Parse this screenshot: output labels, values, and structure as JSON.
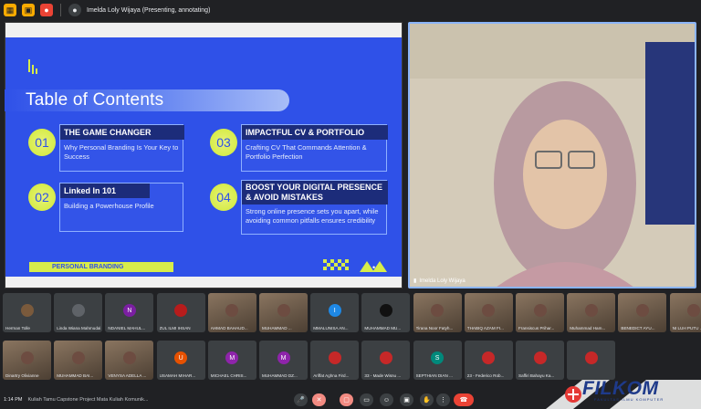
{
  "topbar": {
    "presenter_title": "Imelda Loly Wijaya (Presenting, annotating)"
  },
  "slide": {
    "title": "Table of Contents",
    "items": [
      {
        "num": "01",
        "heading": "THE GAME CHANGER",
        "text": "Why Personal Branding Is Your Key to Success"
      },
      {
        "num": "02",
        "heading": "Linked In 101",
        "text": "Building a Powerhouse Profile"
      },
      {
        "num": "03",
        "heading": "IMPACTFUL CV & PORTFOLIO",
        "text": "Crafting CV That Commands Attention & Portfolio Perfection"
      },
      {
        "num": "04",
        "heading": "BOOST YOUR DIGITAL PRESENCE & AVOID MISTAKES",
        "heading_line1": "BOOST YOUR DIGITAL PRESENCE",
        "heading_line2": "& AVOID MISTAKES",
        "text": "Strong online presence sets you apart, while avoiding common pitfalls ensures credibility"
      }
    ],
    "footer_label": "PERSONAL BRANDING",
    "dots": "•••"
  },
  "speaker": {
    "name": "Imelda Loly Wijaya"
  },
  "participants": [
    {
      "name": "Herman Tolle",
      "initial": "",
      "color": "#7a5a3c",
      "camera": false
    },
    {
      "name": "Linda Wiana Mahmudah",
      "initial": "",
      "color": "#5f6368",
      "camera": false
    },
    {
      "name": "NDANIEL MAHUL...",
      "initial": "N",
      "color": "#7b1fa2",
      "camera": false
    },
    {
      "name": "ZUL ILMI IHSAN",
      "initial": "",
      "color": "#b71c1c",
      "camera": false
    },
    {
      "name": "AHMAD BAHAUD...",
      "initial": "",
      "color": "#6d4c41",
      "camera": true
    },
    {
      "name": "MUHAMMAD ...",
      "initial": "",
      "color": "#6d4c41",
      "camera": true
    },
    {
      "name": "MMALUNISA AN...",
      "initial": "I",
      "color": "#1e88e5",
      "camera": false
    },
    {
      "name": "MUHAMMAD MU...",
      "initial": "",
      "color": "#111111",
      "camera": false
    },
    {
      "name": "Tirana Noor Fatyh...",
      "initial": "",
      "color": "#6d4c41",
      "camera": true
    },
    {
      "name": "THABIQ AZAM FI...",
      "initial": "",
      "color": "#6d4c41",
      "camera": true
    },
    {
      "name": "Fransiscus Prihar...",
      "initial": "",
      "color": "#6d4c41",
      "camera": true
    },
    {
      "name": "Muhammad Ham...",
      "initial": "",
      "color": "#6d4c41",
      "camera": true
    },
    {
      "name": "BENEDICT AYU...",
      "initial": "",
      "color": "#6d4c41",
      "camera": true
    },
    {
      "name": "NI LUH PUTU ...",
      "initial": "",
      "color": "#6d4c41",
      "camera": true
    },
    {
      "name": "Dinartry Olivianne",
      "initial": "",
      "color": "#6d4c41",
      "camera": true
    },
    {
      "name": "MUHAMMAD BAI...",
      "initial": "",
      "color": "#6d4c41",
      "camera": true
    },
    {
      "name": "VENYSA ADELLA ...",
      "initial": "",
      "color": "#6d4c41",
      "camera": true
    },
    {
      "name": "USAMAH MIHAR...",
      "initial": "U",
      "color": "#e65100",
      "camera": false
    },
    {
      "name": "MICHAEL CHRIS...",
      "initial": "M",
      "color": "#8e24aa",
      "camera": false
    },
    {
      "name": "MUHAMMAD DZ...",
      "initial": "M",
      "color": "#8e24aa",
      "camera": false
    },
    {
      "name": "Ariffat Aghna Fird...",
      "initial": "",
      "color": "#c62828",
      "camera": false
    },
    {
      "name": "33 - Made Wisnu ...",
      "initial": "",
      "color": "#c62828",
      "camera": false
    },
    {
      "name": "SEPTHIAN DIAN ...",
      "initial": "S",
      "color": "#00897b",
      "camera": false
    },
    {
      "name": "23 - Federico Rob...",
      "initial": "",
      "color": "#c62828",
      "camera": false
    },
    {
      "name": "Saffiri Bahayu Ka...",
      "initial": "",
      "color": "#c62828",
      "camera": false
    },
    {
      "name": "",
      "initial": "",
      "color": "#c62828",
      "camera": false
    }
  ],
  "bottombar": {
    "clock": "1:14 PM",
    "meeting_title": "Kuliah Tamu Capstone Project Mata Kuliah Komunik..."
  },
  "watermark": {
    "brand": "FILKOM",
    "subtitle": "FAKULTAS ILMU KOMPUTER"
  },
  "colors": {
    "slide_bg": "#2f51e8",
    "accent_lime": "#d7ec4a",
    "card_head": "#1c2c7a",
    "end_call_red": "#ea4335"
  }
}
